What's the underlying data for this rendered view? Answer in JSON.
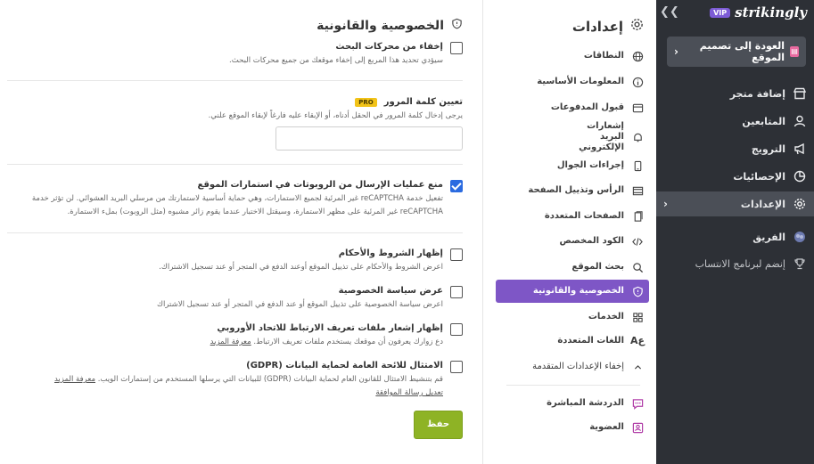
{
  "brand": {
    "name": "strikingly",
    "badge": "VIP"
  },
  "sidebar": {
    "back_label": "العودة إلى تصميم الموقع",
    "items": [
      {
        "label": "إضافة متجر",
        "icon": "store-icon"
      },
      {
        "label": "المتابعين",
        "icon": "people-icon"
      },
      {
        "label": "الترويج",
        "icon": "megaphone-icon"
      },
      {
        "label": "الإحصائيات",
        "icon": "pie-chart-icon"
      },
      {
        "label": "الإعدادات",
        "icon": "gear-icon",
        "active": true
      },
      {
        "label": "الفريق",
        "icon": "team-avatar-icon"
      },
      {
        "label": "إنضم لبرنامج الانتساب",
        "icon": "trophy-icon"
      }
    ]
  },
  "settings_nav": {
    "title": "إعدادات",
    "items": [
      {
        "label": "النطاقات"
      },
      {
        "label": "المعلومات الأساسية"
      },
      {
        "label": "قبول المدفوعات"
      },
      {
        "label": "إشعارات البريد الإلكتروني"
      },
      {
        "label": "إجراءات الجوال"
      },
      {
        "label": "الرأس وتذييل الصفحة"
      },
      {
        "label": "الصفحات المتعددة"
      },
      {
        "label": "الكود المخصص"
      },
      {
        "label": "بحث الموقع"
      },
      {
        "label": "الخصوصية والقانونية",
        "active": true
      },
      {
        "label": "الخدمات"
      },
      {
        "label": "اللغات المتعددة"
      },
      {
        "label": "إخفاء الإعدادات المتقدمة"
      },
      {
        "label": "الدردشة المباشرة"
      },
      {
        "label": "العضوية"
      }
    ]
  },
  "main": {
    "title": "الخصوصية والقانونية",
    "hide_search": {
      "label": "إخفاء من محركات البحث",
      "desc": "سيؤدي تحديد هذا المربع إلى إخفاء موقعك من جميع محركات البحث.",
      "checked": false
    },
    "password": {
      "label": "تعيين كلمة المرور",
      "badge": "PRO",
      "desc": "يرجى إدخال كلمة المرور في الحقل أدناه، أو الإبقاء عليه فارغاً لإبقاء الموقع علني.",
      "value": ""
    },
    "recaptcha": {
      "label": "منع عمليات الإرسال من الروبوتات في استمارات الموقع",
      "desc1": "تفعيل خدمة reCAPTCHA غير المرئية لجميع الاستمارات، وهي حماية أساسية لاستمارتك من مرسلي البريد العشوائي. لن تؤثر خدمة",
      "desc2": "reCAPTCHA غير المرئية على مظهر الاستمارة، وسيقتل الاختبار عندما يقوم زائر مشبوه (مثل الروبوت) بملء الاستمارة.",
      "checked": true
    },
    "terms": {
      "label": "إظهار الشروط والأحكام",
      "desc": "اعرض الشروط والأحكام على تذييل الموقع أوعند الدفع في المتجر أو عند تسجيل الاشتراك.",
      "checked": false
    },
    "privacy": {
      "label": "عرض سياسة الخصوصية",
      "desc": "اعرض سياسة الخصوصية على تذييل الموقع أو عند الدفع في المتجر أو عند تسجيل الاشتراك",
      "checked": false
    },
    "cookies": {
      "label": "إظهار إشعار ملفات تعريف الارتباط للاتحاد الأوروبي",
      "desc": "دع زوارك يعرفون أن موقعك يستخدم ملفات تعريف الارتباط.",
      "link": "معرفة المزيد",
      "checked": false
    },
    "gdpr": {
      "label": "الامتثال للائحة العامة لحماية البيانات (GDPR)",
      "desc": "قم بتنشيط الامتثال للقانون العام لحماية البيانات (GDPR) للبيانات التي يرسلها المستخدم من إستمارات الويب.",
      "link": "معرفة المزيد",
      "link2": "تعديل رسالة الموافقة",
      "checked": false
    },
    "save_label": "حفظ"
  }
}
